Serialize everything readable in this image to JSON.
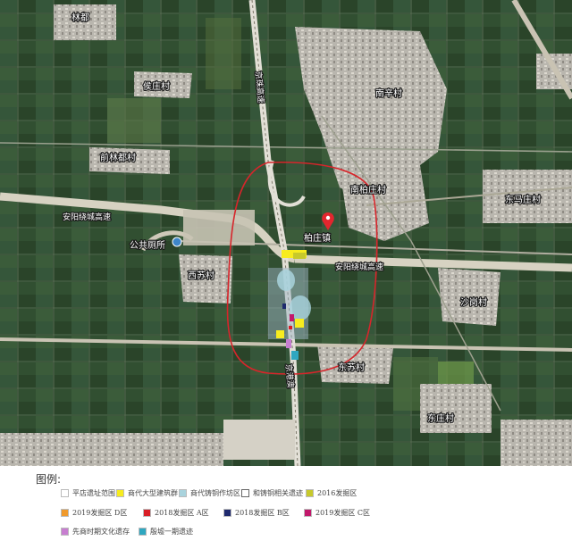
{
  "map": {
    "places": {
      "lin_du": "林都",
      "hou_zhuang": "侯庄村",
      "qian_lin_du": "前林都村",
      "nan_xin": "南辛村",
      "nan_bai_zhuang": "南柏庄村",
      "dong_ma_zhuang": "东马庄村",
      "bai_zhuang_zhen": "柏庄镇",
      "gong_ce": "公共厕所",
      "xi_su": "西苏村",
      "sha_gang": "沙岗村",
      "dong_su": "东苏村",
      "dong_zhuang": "东庄村"
    },
    "roads": {
      "highway_west": "安阳绕城高速",
      "highway_east": "安阳绕城高速",
      "rail_north": "京珠高速",
      "rail_south": "京港澳"
    }
  },
  "legend": {
    "title": "图例:",
    "items": [
      {
        "label": "平店遗址范围",
        "color": "#ffffff"
      },
      {
        "label": "商代大型建筑群",
        "color": "#f7ec1e"
      },
      {
        "label": "商代铸铜作坊区",
        "color": "#a9d3dd"
      },
      {
        "label": "和铸铜相关遗迹",
        "color": "#ffffff"
      },
      {
        "label": "2016发掘区",
        "color": "#c7c92b"
      },
      {
        "label": "2019发掘区 D区",
        "color": "#f09a2c"
      },
      {
        "label": "2018发掘区 A区",
        "color": "#d91e26"
      },
      {
        "label": "2018发掘区 B区",
        "color": "#1f2a6e"
      },
      {
        "label": "2019发掘区 C区",
        "color": "#c2186b"
      },
      {
        "label": "先商时期文化遗存",
        "color": "#c77ed0"
      },
      {
        "label": "殷墟一期遗迹",
        "color": "#2fa7c0"
      }
    ]
  }
}
